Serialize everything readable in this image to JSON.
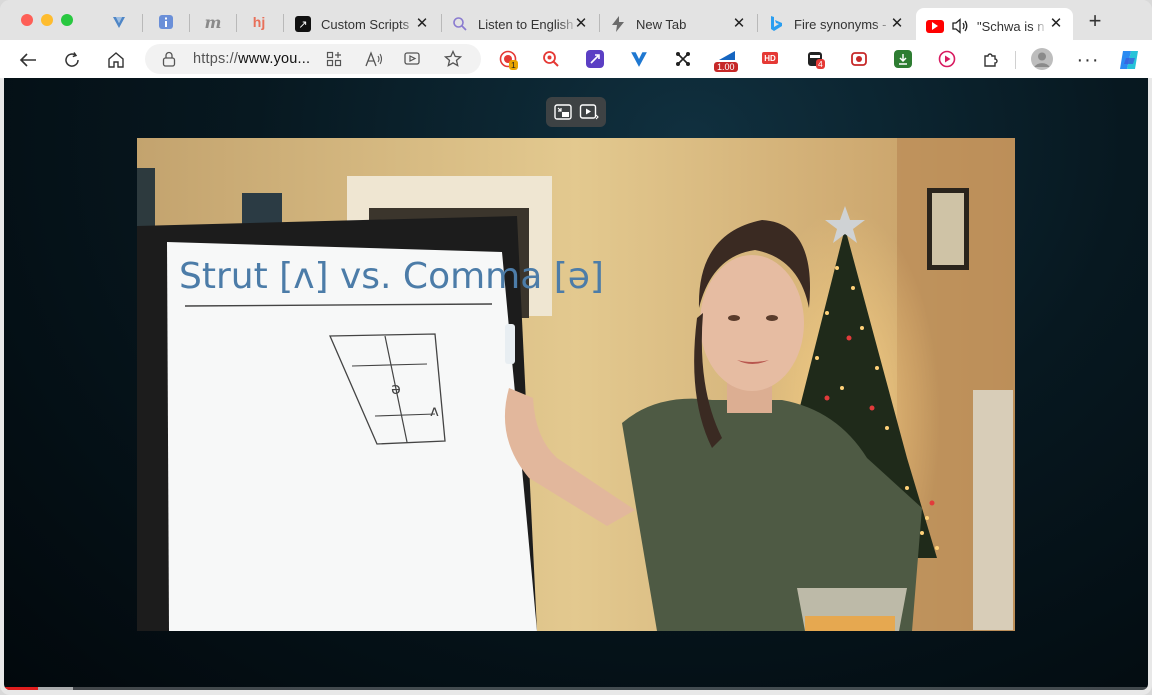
{
  "tabs": {
    "pinned": [
      {
        "name": "pinned-tab-vuetify",
        "glyph": "V",
        "color": "#5e8ec8"
      },
      {
        "name": "pinned-tab-info",
        "glyph": "i",
        "color": "#6a8fd8"
      },
      {
        "name": "pinned-tab-m",
        "glyph": "m",
        "color": "#8a8a8a"
      },
      {
        "name": "pinned-tab-hj",
        "glyph": "hj",
        "color": "#e8705a"
      }
    ],
    "items": [
      {
        "title": "Custom Scripts",
        "icon": "arrow-up-right-icon"
      },
      {
        "title": "Listen to English",
        "icon": "search-icon"
      },
      {
        "title": "New Tab",
        "icon": "lightning-icon"
      },
      {
        "title": "Fire synonyms -",
        "icon": "bing-icon"
      },
      {
        "title": "\"Schwa is n",
        "icon": "youtube-icon",
        "active": true,
        "audio": true
      }
    ],
    "close_glyph": "✕",
    "new_tab_glyph": "+"
  },
  "toolbar": {
    "url_prefix": "https://",
    "url_host": "www.you...",
    "extensions": [
      {
        "name": "ext-record",
        "badge": "1",
        "badge_color": "#e8a400",
        "color": "#e53935"
      },
      {
        "name": "ext-search-red",
        "color": "#e53935"
      },
      {
        "name": "ext-purple",
        "color": "#5b3fc4"
      },
      {
        "name": "ext-vuetify",
        "color": "#1f78d1"
      },
      {
        "name": "ext-nodes",
        "color": "#222222"
      },
      {
        "name": "ext-speed",
        "badge": "1.00",
        "badge_color": "#c62828",
        "color": "#1565c0"
      },
      {
        "name": "ext-hd",
        "label": "HD",
        "color": "#e53935"
      },
      {
        "name": "ext-dark",
        "badge": "4",
        "badge_color": "#e53935",
        "color": "#222222"
      },
      {
        "name": "ext-video-red",
        "color": "#c62828"
      },
      {
        "name": "ext-download",
        "color": "#2e7d32"
      },
      {
        "name": "ext-play",
        "color": "#d81b60"
      }
    ]
  },
  "video": {
    "board_title": "Strut [ʌ] vs. Comma [ə]",
    "chart_symbols": [
      "ə",
      "ʌ"
    ]
  },
  "player": {
    "played_fraction": 0.03,
    "buffered_fraction": 0.06
  }
}
